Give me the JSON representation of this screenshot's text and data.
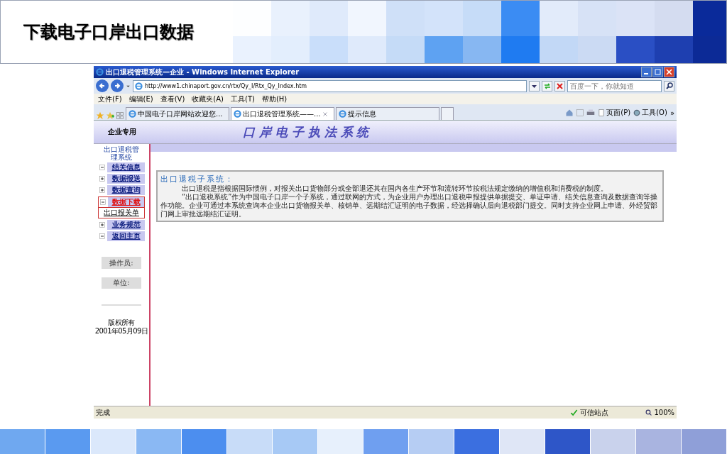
{
  "slide": {
    "title": "下载电子口岸出口数据"
  },
  "browser": {
    "title": "出口退税管理系统—企业 - Windows Internet Explorer",
    "address": "http://www1.chinaport.gov.cn/rtx/Qy_I/Rtx_Qy_Index.htm",
    "search_placeholder": "百度一下，你就知道",
    "menu": [
      "文件(F)",
      "编辑(E)",
      "查看(V)",
      "收藏夹(A)",
      "工具(T)",
      "帮助(H)"
    ],
    "tabs": [
      {
        "label": "中国电子口岸网站欢迎您...",
        "selected": false
      },
      {
        "label": "出口退税管理系统——...",
        "selected": true
      },
      {
        "label": "提示信息",
        "selected": false
      }
    ],
    "tools": [
      "页面(P)",
      "工具(O)"
    ],
    "overflow": "»",
    "status": {
      "text": "完成",
      "zone": "可信站点",
      "zoom": "100%"
    }
  },
  "page": {
    "badge": "企业专用",
    "banner": "口 岸 电 子 执 法 系 统",
    "sidebar": {
      "title": "出口退税管理系统",
      "items": [
        {
          "label": "结关信息",
          "expanded": true,
          "selected": false
        },
        {
          "label": "数据报送",
          "expanded": false,
          "selected": false
        },
        {
          "label": "数据查询",
          "expanded": false,
          "selected": false
        },
        {
          "label": "数据下载",
          "expanded": true,
          "selected": true,
          "children": [
            {
              "label": "出口报关单"
            }
          ]
        },
        {
          "label": "业务规范",
          "expanded": false,
          "selected": false
        },
        {
          "label": "返回主页",
          "expanded": true,
          "selected": false
        }
      ],
      "operator_label": "操作员:",
      "unit_label": "单位:",
      "copyright": [
        "版权所有",
        "2001年05月09日"
      ]
    },
    "intro": {
      "heading": "出口退税子系统：",
      "paragraphs": [
        "出口退税是指根据国际惯例，对报关出口货物部分或全部退还其在国内各生产环节和流转环节按税法规定缴纳的增值税和消费税的制度。",
        "“出口退税系统”作为中国电子口岸一个子系统，通过联网的方式，为企业用户办理出口退税申报提供单据提交、单证申请、结关信息查询及数据查询等操作功能。企业可通过本系统查询本企业出口货物报关单、核销单、远期结汇证明的电子数据，经选择确认后向退税部门提交。同时支持企业网上申请、外经贸部门网上审批远期结汇证明。"
      ]
    }
  }
}
